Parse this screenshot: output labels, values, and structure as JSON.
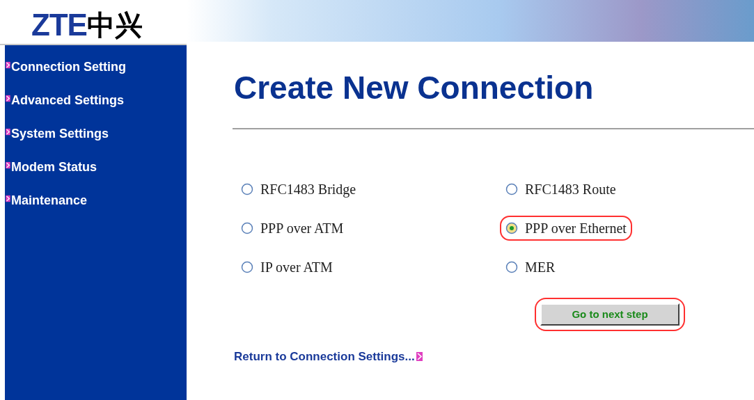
{
  "logo": {
    "latin": "ZTE",
    "chinese": "中兴"
  },
  "sidebar": {
    "items": [
      {
        "label": "Connection Setting"
      },
      {
        "label": "Advanced Settings"
      },
      {
        "label": "System Settings"
      },
      {
        "label": "Modem Status"
      },
      {
        "label": "Maintenance"
      }
    ]
  },
  "title": "Create New Connection",
  "options": [
    {
      "label": "RFC1483 Bridge",
      "selected": false,
      "highlighted": false
    },
    {
      "label": "RFC1483 Route",
      "selected": false,
      "highlighted": false
    },
    {
      "label": "PPP over ATM",
      "selected": false,
      "highlighted": false
    },
    {
      "label": "PPP over Ethernet",
      "selected": true,
      "highlighted": true
    },
    {
      "label": "IP over ATM",
      "selected": false,
      "highlighted": false
    },
    {
      "label": "MER",
      "selected": false,
      "highlighted": false
    }
  ],
  "next_button": {
    "label": "Go to next step",
    "highlighted": true
  },
  "return_link": "Return to Connection Settings..."
}
